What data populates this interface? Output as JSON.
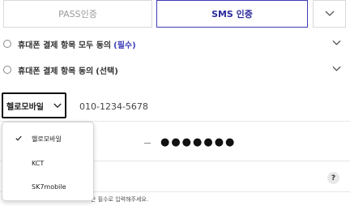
{
  "tabs": {
    "pass_label": "PASS인증",
    "sms_label": "SMS 인증",
    "more_icon": "chevron-down-icon"
  },
  "consents": [
    {
      "text": "휴대폰 결제 항목 모두 동의",
      "tag": "(필수)",
      "tag_color": "#3d3bb8"
    },
    {
      "text": "휴대폰 결제 항목 동의",
      "tag": "(선택)",
      "tag_color": "#333333"
    }
  ],
  "carrier": {
    "selected": "헬로모바일",
    "options": [
      "헬로모바일",
      "KCT",
      "SK7mobile"
    ],
    "checked_index": 0
  },
  "phone": {
    "placeholder": "010-1234-5678"
  },
  "birth": {
    "masked": "●●●●●●●"
  },
  "help": {
    "label": "?"
  },
  "footnote": "은 필수로 입력해주세요.",
  "colors": {
    "accent": "#3d3bb8",
    "border": "#d9d9d9"
  }
}
